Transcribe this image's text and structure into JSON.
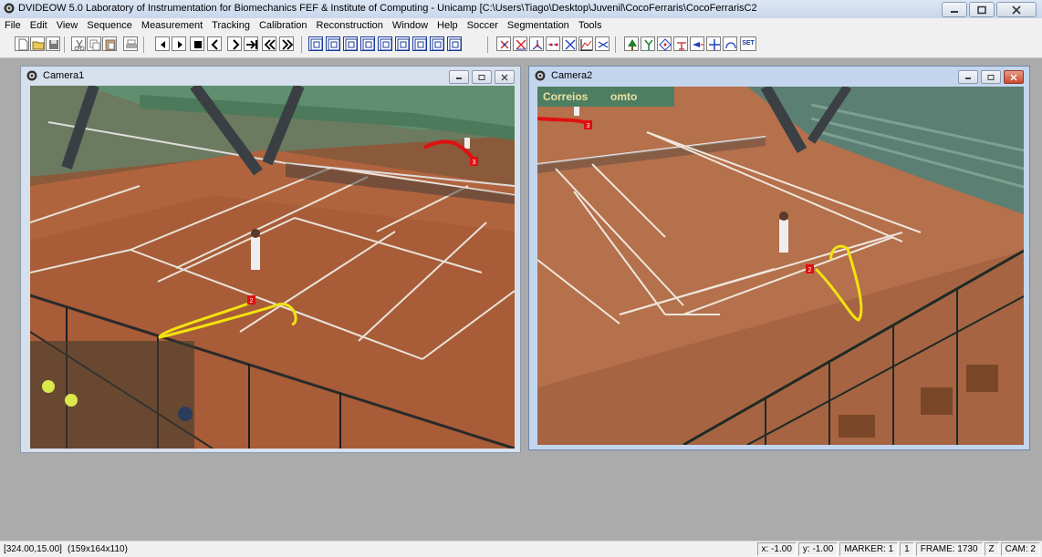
{
  "app": {
    "title": "DVIDEOW 5.0  Laboratory of Instrumentation for Biomechanics FEF & Institute of Computing - Unicamp [C:\\Users\\Tiago\\Desktop\\Juvenil\\CocoFerraris\\CocoFerrarisC2"
  },
  "menu": {
    "items": [
      "File",
      "Edit",
      "View",
      "Sequence",
      "Measurement",
      "Tracking",
      "Calibration",
      "Reconstruction",
      "Window",
      "Help",
      "Soccer",
      "Segmentation",
      "Tools"
    ]
  },
  "toolbar": {
    "icons": [
      "new-file-icon",
      "open-folder-icon",
      "save-icon",
      "cut-icon",
      "copy-icon",
      "paste-icon",
      "print-icon",
      "step-back-icon",
      "step-forward-icon",
      "stop-icon",
      "prev-frame-icon",
      "next-frame-icon",
      "last-frame-icon",
      "rewind-icon",
      "fast-forward-icon",
      "view-1-icon",
      "view-2-icon",
      "view-3-icon",
      "view-4-icon",
      "view-5-icon",
      "view-6-icon",
      "view-7-icon",
      "view-8-icon",
      "view-9-icon",
      "marker-select-icon",
      "marker-cross-icon",
      "marker-point-icon",
      "marker-line-icon",
      "marker-x-icon",
      "marker-chart-icon",
      "marker-link-icon",
      "tree-icon",
      "split-icon",
      "diamond-icon",
      "cap-icon",
      "flag-icon",
      "cross-icon",
      "curve-icon",
      "set-icon"
    ],
    "set_label": "SET"
  },
  "camera1": {
    "title": "Camera1",
    "markers": {
      "m1": "3",
      "m2": "2"
    },
    "colors": {
      "trail_red": "#e01010",
      "trail_yellow": "#f2e20e"
    }
  },
  "camera2": {
    "title": "Camera2",
    "markers": {
      "m1": "3",
      "m2": "2"
    },
    "banner_left": "Correios",
    "banner_right": "omto"
  },
  "status": {
    "coords": "[324.00,15.00]",
    "size": "(159x164x110)",
    "x": "x: -1.00",
    "y": "y: -1.00",
    "marker": "MARKER: 1",
    "marker_n": "1",
    "frame": "FRAME: 1730",
    "z": "Z",
    "cam": "CAM: 2"
  }
}
